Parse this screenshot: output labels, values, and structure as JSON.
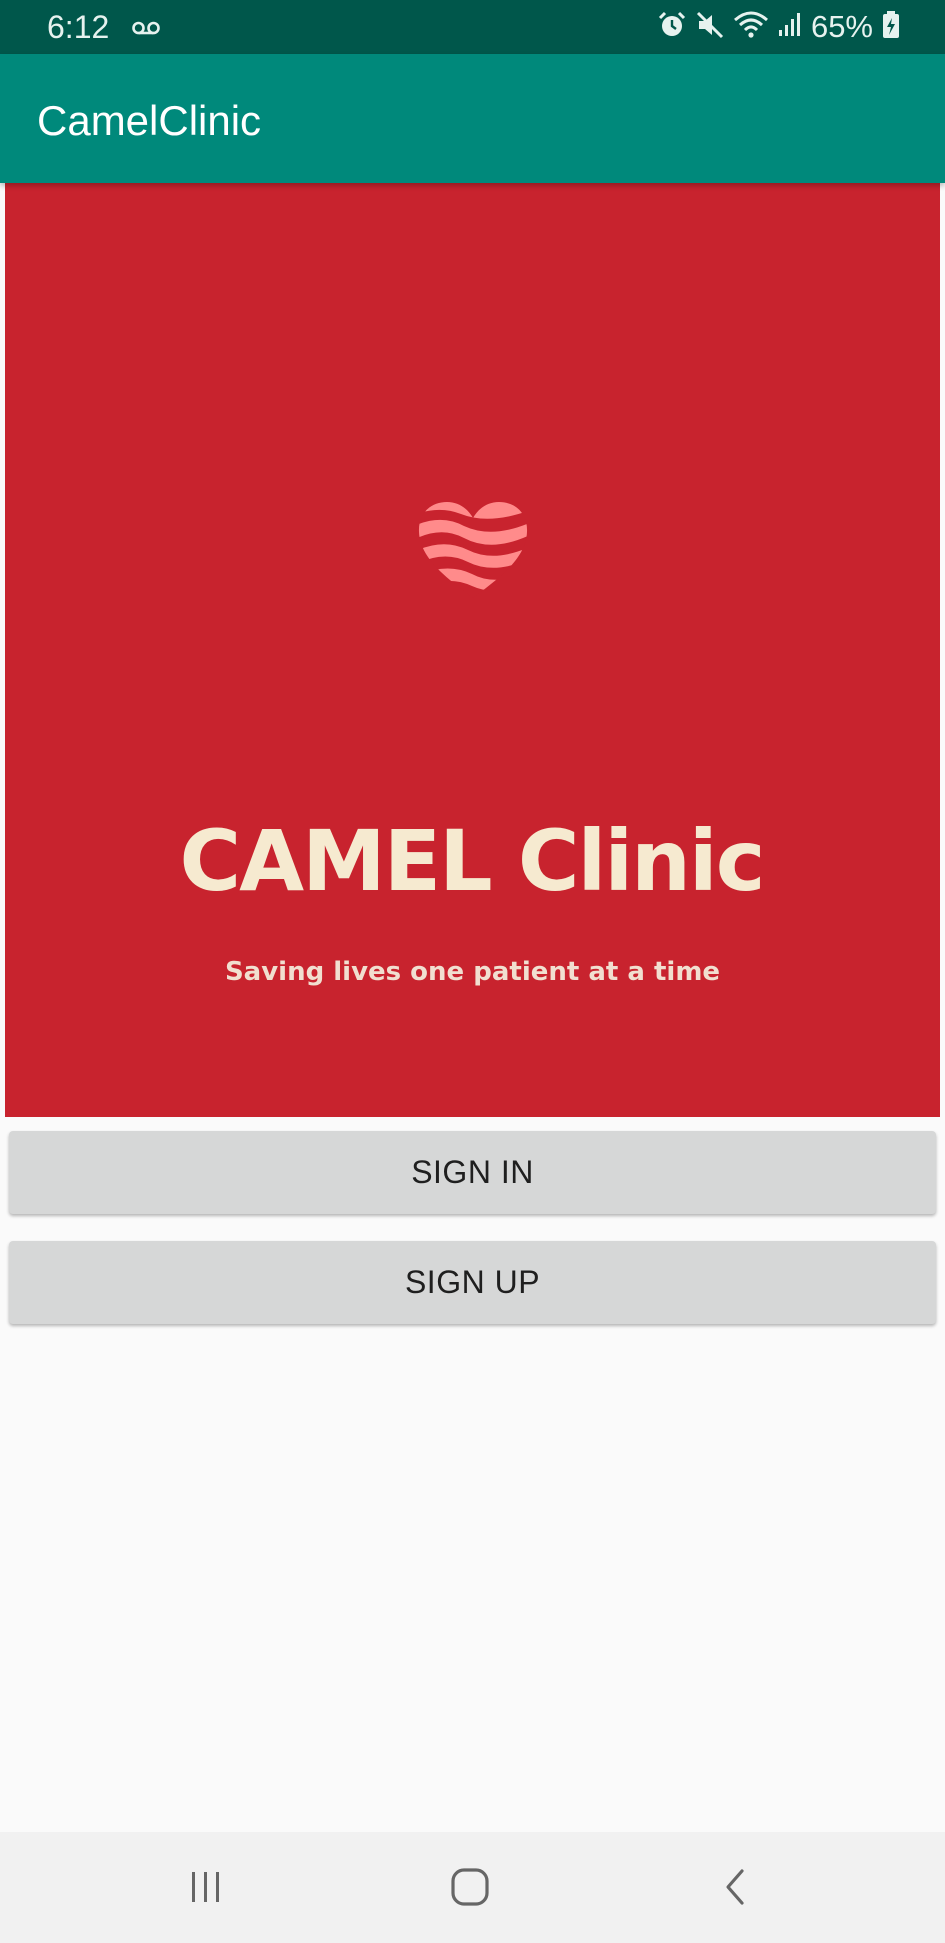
{
  "status_bar": {
    "time": "6:12",
    "battery_percent": "65%",
    "icons": [
      "voicemail-icon",
      "alarm-icon",
      "mute-icon",
      "wifi-icon",
      "signal-icon",
      "battery-charging-icon"
    ]
  },
  "app_bar": {
    "title": "CamelClinic"
  },
  "banner": {
    "logo_text": "CAMEL Clinic",
    "tagline": "Saving lives one patient at a time",
    "colors": {
      "background": "#c8232e",
      "heart": "#ff8b8b",
      "text": "#f6ead0"
    }
  },
  "actions": {
    "sign_in_label": "SIGN IN",
    "sign_up_label": "SIGN UP"
  },
  "nav_bar": {
    "icons": [
      "recents-icon",
      "home-icon",
      "back-icon"
    ]
  },
  "theme": {
    "status_bar": "#00574b",
    "app_bar": "#00897b",
    "button": "#d6d7d7",
    "background": "#fafafa"
  }
}
